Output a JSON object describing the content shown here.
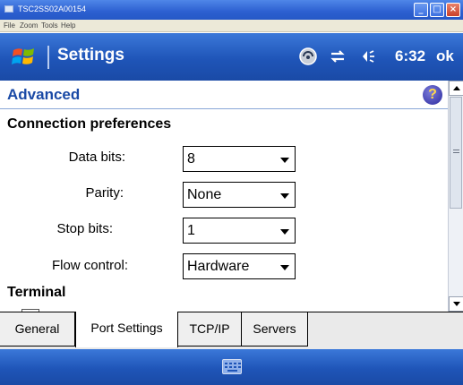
{
  "host_window": {
    "title": "TSC2SS02A00154",
    "menu": [
      "File",
      "Zoom",
      "Tools",
      "Help"
    ]
  },
  "topbar": {
    "title": "Settings",
    "clock": "6:32",
    "ok_label": "ok",
    "icons": [
      "windows-start-icon",
      "connectivity-icon",
      "data-transfer-icon",
      "volume-icon"
    ]
  },
  "page": {
    "title": "Advanced"
  },
  "sections": {
    "connection_preferences": "Connection preferences",
    "terminal": "Terminal"
  },
  "fields": [
    {
      "label": "Data bits:",
      "value": "8"
    },
    {
      "label": "Parity:",
      "value": "None"
    },
    {
      "label": "Stop bits:",
      "value": "1"
    },
    {
      "label": "Flow control:",
      "value": "Hardware"
    }
  ],
  "tabs": [
    {
      "label": "General",
      "active": false
    },
    {
      "label": "Port Settings",
      "active": true
    },
    {
      "label": "TCP/IP",
      "active": false
    },
    {
      "label": "Servers",
      "active": false
    }
  ],
  "colors": {
    "accent": "#1f55b8",
    "page_title": "#1a4aa6",
    "help_icon": "#2b2aa0"
  }
}
